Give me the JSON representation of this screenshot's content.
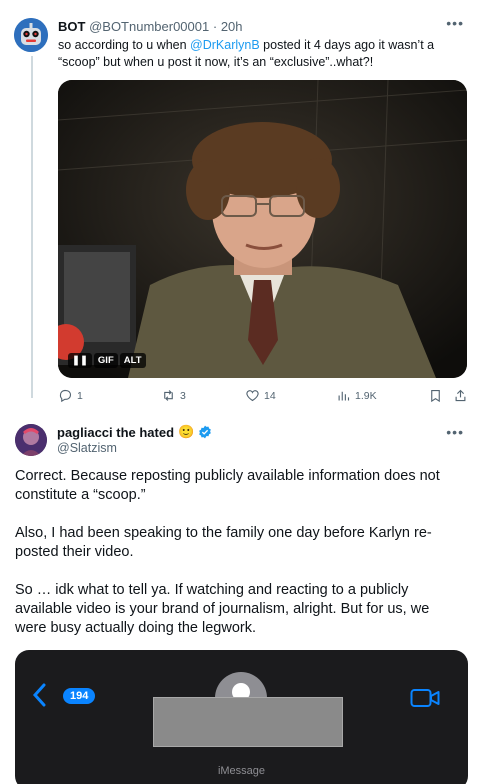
{
  "tweet1": {
    "display_name": "BOT",
    "handle": "@BOTnumber00001",
    "separator": "·",
    "time": "20h",
    "text_before": "so according to u when ",
    "mention": "@DrKarlynB",
    "text_after": " posted it 4 days ago it wasn’t a “scoop” but when u post it now, it’s an “exclusive”..what?!",
    "gif_badge": "GIF",
    "alt_badge": "ALT",
    "actions": {
      "replies": "1",
      "retweets": "3",
      "likes": "14",
      "views": "1.9K"
    }
  },
  "tweet2": {
    "display_name": "pagliacci the hated",
    "emoji": "🙂",
    "handle": "@Slatzism",
    "paragraphs": [
      "Correct. Because reposting publicly available information does not constitute a “scoop.”",
      "Also, I had been speaking to the family one day before Karlyn re-posted their video.",
      "So … idk what to tell ya. If watching and reacting to a publicly available video is your brand of journalism, alright. But for us, we were busy actually doing the legwork."
    ],
    "attachment": {
      "back_count": "194",
      "footer": "iMessage"
    }
  },
  "colors": {
    "link": "#1d9bf0",
    "muted": "#536471",
    "imessage_blue": "#0a84ff"
  }
}
